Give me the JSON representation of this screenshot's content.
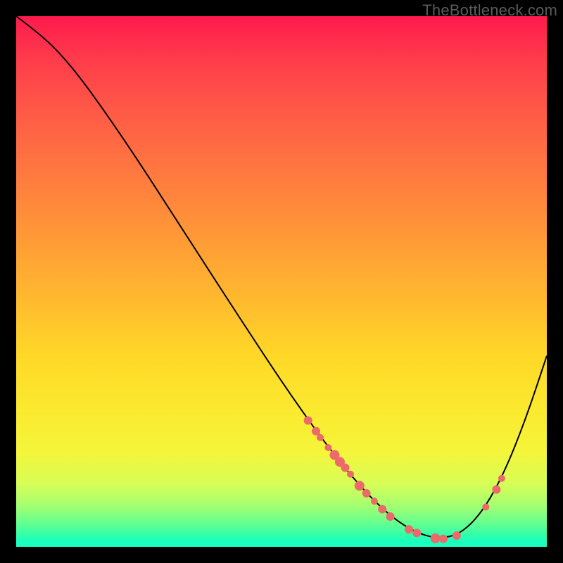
{
  "watermark": "TheBottleneck.com",
  "chart_data": {
    "type": "line",
    "title": "",
    "xlabel": "",
    "ylabel": "",
    "xlim": [
      0,
      100
    ],
    "ylim": [
      0,
      100
    ],
    "curve": [
      {
        "x": 0.0,
        "y": 100.0
      },
      {
        "x": 4.0,
        "y": 97.0
      },
      {
        "x": 8.0,
        "y": 93.3
      },
      {
        "x": 12.0,
        "y": 88.5
      },
      {
        "x": 16.0,
        "y": 83.0
      },
      {
        "x": 20.0,
        "y": 77.2
      },
      {
        "x": 24.0,
        "y": 71.2
      },
      {
        "x": 28.0,
        "y": 65.0
      },
      {
        "x": 32.0,
        "y": 58.8
      },
      {
        "x": 36.0,
        "y": 52.6
      },
      {
        "x": 40.0,
        "y": 46.4
      },
      {
        "x": 44.0,
        "y": 40.3
      },
      {
        "x": 48.0,
        "y": 34.2
      },
      {
        "x": 52.0,
        "y": 28.3
      },
      {
        "x": 56.0,
        "y": 22.6
      },
      {
        "x": 60.0,
        "y": 17.3
      },
      {
        "x": 64.0,
        "y": 12.4
      },
      {
        "x": 68.0,
        "y": 8.1
      },
      {
        "x": 72.0,
        "y": 4.7
      },
      {
        "x": 76.0,
        "y": 2.4
      },
      {
        "x": 80.0,
        "y": 1.5
      },
      {
        "x": 84.0,
        "y": 2.6
      },
      {
        "x": 88.0,
        "y": 6.8
      },
      {
        "x": 92.0,
        "y": 14.0
      },
      {
        "x": 96.0,
        "y": 24.0
      },
      {
        "x": 100.0,
        "y": 36.0
      }
    ],
    "markers": [
      {
        "x": 55.0,
        "y": 23.8,
        "r": 6
      },
      {
        "x": 56.5,
        "y": 21.8,
        "r": 6
      },
      {
        "x": 57.3,
        "y": 20.6,
        "r": 5
      },
      {
        "x": 58.8,
        "y": 18.7,
        "r": 5
      },
      {
        "x": 60.0,
        "y": 17.3,
        "r": 7
      },
      {
        "x": 61.0,
        "y": 16.0,
        "r": 7
      },
      {
        "x": 62.0,
        "y": 14.9,
        "r": 6
      },
      {
        "x": 63.0,
        "y": 13.7,
        "r": 5
      },
      {
        "x": 64.7,
        "y": 11.5,
        "r": 7
      },
      {
        "x": 66.0,
        "y": 10.1,
        "r": 6
      },
      {
        "x": 67.5,
        "y": 8.6,
        "r": 5
      },
      {
        "x": 69.0,
        "y": 7.1,
        "r": 6
      },
      {
        "x": 70.5,
        "y": 5.7,
        "r": 6
      },
      {
        "x": 74.0,
        "y": 3.3,
        "r": 6
      },
      {
        "x": 75.5,
        "y": 2.6,
        "r": 6
      },
      {
        "x": 79.0,
        "y": 1.6,
        "r": 7
      },
      {
        "x": 80.5,
        "y": 1.5,
        "r": 6
      },
      {
        "x": 83.0,
        "y": 2.1,
        "r": 6
      },
      {
        "x": 88.5,
        "y": 7.5,
        "r": 5
      },
      {
        "x": 90.5,
        "y": 10.8,
        "r": 6
      },
      {
        "x": 91.5,
        "y": 12.9,
        "r": 5
      }
    ]
  }
}
